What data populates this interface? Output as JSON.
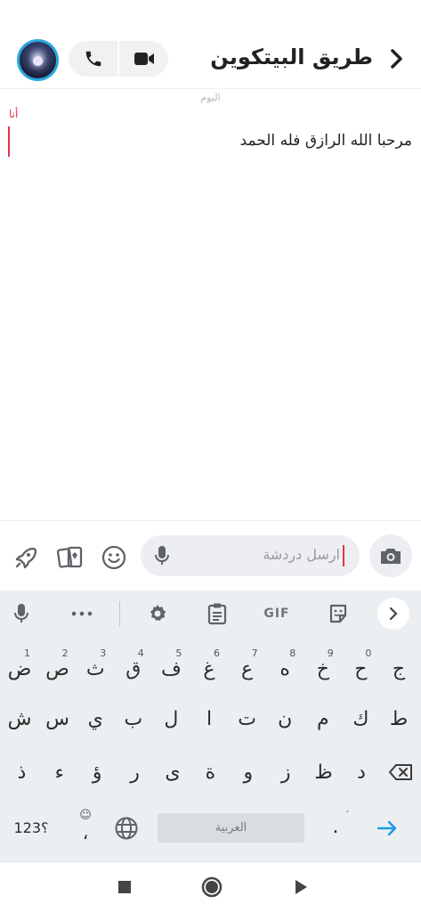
{
  "header": {
    "title": "طريق البيتكوين",
    "back_icon": "chevron-right-icon",
    "video_icon": "video-camera-icon",
    "call_icon": "phone-icon",
    "avatar_icon": "avatar"
  },
  "chat": {
    "day_label": "اليوم",
    "sender": "أنا",
    "message": "مرحبا  الله الرازق فله الحمد",
    "accent_color": "#e0344b"
  },
  "composer": {
    "placeholder": "ارسل دردشة",
    "icons": [
      "camera-icon",
      "mic-icon",
      "smiley-icon",
      "cards-icon",
      "rocket-icon"
    ]
  },
  "keyboard": {
    "toolbar": [
      "mic-icon",
      "more-icon",
      "settings-icon",
      "clipboard-icon",
      "GIF",
      "sticker-icon",
      "chevron-right-icon"
    ],
    "gif_label": "GIF",
    "row1": [
      "ج",
      "ح",
      "خ",
      "ه",
      "ع",
      "غ",
      "ف",
      "ق",
      "ث",
      "ص",
      "ض"
    ],
    "row1_hints": [
      "",
      "0",
      "9",
      "8",
      "7",
      "6",
      "5",
      "4",
      "3",
      "2",
      "1"
    ],
    "row2": [
      "ط",
      "ك",
      "م",
      "ن",
      "ت",
      "ا",
      "ل",
      "ب",
      "ي",
      "س",
      "ش"
    ],
    "row3": [
      "د",
      "ظ",
      "ز",
      "و",
      "ة",
      "ى",
      "ر",
      "ؤ",
      "ء",
      "ذ"
    ],
    "num_label": "؟123",
    "comma": "،",
    "period": ".",
    "space_label": "العربية",
    "enter_color": "#1a9be6"
  },
  "nav": {
    "icons": [
      "recents-square-icon",
      "home-circle-icon",
      "back-triangle-icon"
    ]
  }
}
